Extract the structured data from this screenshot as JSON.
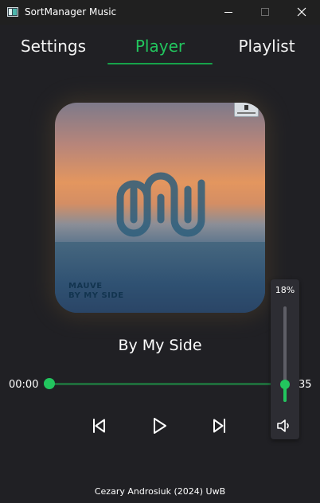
{
  "window": {
    "title": "SortManager Music",
    "icon": "app-icon",
    "controls": [
      "minimize-icon",
      "maximize-icon",
      "close-icon"
    ]
  },
  "tabs": [
    {
      "label": "Settings",
      "active": false
    },
    {
      "label": "Player",
      "active": true
    },
    {
      "label": "Playlist",
      "active": false
    }
  ],
  "colors": {
    "accent": "#22c55e",
    "background": "#202024",
    "titlebar": "#202020"
  },
  "album": {
    "artist_text": "MAUVE",
    "album_text": "BY MY SIDE"
  },
  "player": {
    "song_title": "By My Side",
    "time_current": "00:00",
    "time_total_visible": "35",
    "progress_fraction": 0.0,
    "controls": [
      "previous-icon",
      "play-icon",
      "next-icon",
      "volume-icon"
    ]
  },
  "volume": {
    "label": "18%",
    "fraction": 0.18
  },
  "footer": {
    "text": "Cezary Androsiuk (2024) UwB"
  }
}
